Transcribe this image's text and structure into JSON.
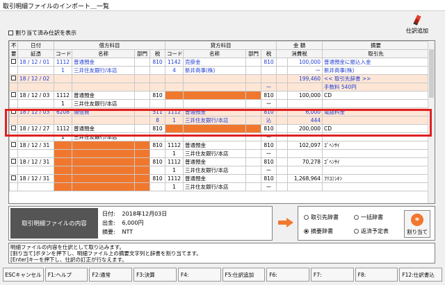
{
  "window": {
    "title": "取引明細ファイルのインポート＿一覧"
  },
  "toolbar": {
    "add_label": "仕訳追加"
  },
  "filter": {
    "show_assigned_label": "割り当て済み仕訳を表示"
  },
  "table": {
    "group_headers": {
      "nofuyo": "不",
      "date": "日付",
      "debit": "借方科目",
      "credit": "貸方科目",
      "amount": "金 額",
      "summary": "摘要"
    },
    "sub_headers": {
      "nofuyo": "要",
      "voucher": "証憑",
      "code": "コード",
      "name": "名称",
      "dept": "部門",
      "tax": "税",
      "tax_amount": "消費税",
      "partner": "取引先"
    },
    "rows": [
      {
        "style": "blue white",
        "check": true,
        "date": "18 / 12 / 01",
        "dcode": "1112",
        "dname": "普通預金",
        "ddept": "",
        "dtax": "810",
        "ccode": "1142",
        "cname": "売掛金",
        "cdept": "",
        "ctax": "810",
        "amount": "100,000",
        "summary": "普通預金に振込入金"
      },
      {
        "style": "blue white",
        "check": false,
        "date": "",
        "dcode": "1",
        "dname": "三井住友銀行/本店",
        "ddept": "",
        "dtax": "",
        "ccode": "4",
        "cname": "新井商事(株)",
        "cdept": "",
        "ctax": "",
        "amount": "ー",
        "summary": "新井商事(株)"
      },
      {
        "style": "blue peach",
        "check": true,
        "date": "18 / 12 / 02",
        "dcode": "",
        "dname": "",
        "ddept": "",
        "dtax": "",
        "ccode": "",
        "cname": "",
        "cdept": "",
        "ctax": "",
        "amount": "199,460",
        "summary": "<< 取引先辞書 >>"
      },
      {
        "style": "blue peach",
        "check": false,
        "date": "",
        "dcode": "",
        "dname": "",
        "ddept": "",
        "dtax": "",
        "ccode": "",
        "cname": "",
        "cdept": "",
        "ctax": "ー",
        "amount": "",
        "summary": "手数料 540円"
      },
      {
        "style": "white",
        "check": true,
        "date": "18 / 12 / 03",
        "dcode": "1112",
        "dname": "普通預金",
        "ddept": "",
        "dtax": "810",
        "ccode": "",
        "cname": "",
        "cdept": "",
        "ctax": "810",
        "amount": "100,000",
        "summary": "CD",
        "corange": true
      },
      {
        "style": "white",
        "check": false,
        "date": "",
        "dcode": "1",
        "dname": "三井住友銀行/本店",
        "ddept": "",
        "dtax": "",
        "ccode": "",
        "cname": "",
        "cdept": "",
        "ctax": "ー",
        "amount": "",
        "summary": ""
      },
      {
        "style": "blue peach",
        "check": true,
        "date": "18 / 12 / 03",
        "dcode": "6208",
        "dname": "通信費",
        "ddept": "",
        "dtax": "511",
        "ccode": "1112",
        "cname": "普通預金",
        "cdept": "",
        "ctax": "810",
        "amount": "6,000",
        "summary": "電話料金"
      },
      {
        "style": "blue peach",
        "check": false,
        "date": "",
        "dcode": "",
        "dname": "",
        "ddept": "",
        "dtax": "8",
        "ccode": "1",
        "cname": "三井住友銀行/本店",
        "cdept": "",
        "ctax": "込",
        "amount": "444",
        "summary": ""
      },
      {
        "style": "white",
        "check": true,
        "date": "18 / 12 / 27",
        "dcode": "1112",
        "dname": "普通預金",
        "ddept": "",
        "dtax": "810",
        "ccode": "",
        "cname": "",
        "cdept": "",
        "ctax": "810",
        "amount": "200,000",
        "summary": "CD",
        "corange": true
      },
      {
        "style": "white",
        "check": false,
        "date": "",
        "dcode": "1",
        "dname": "三井住友銀行/本店",
        "ddept": "",
        "dtax": "",
        "ccode": "",
        "cname": "",
        "cdept": "",
        "ctax": "ー",
        "amount": "",
        "summary": ""
      },
      {
        "style": "white",
        "check": true,
        "date": "18 / 12 / 31",
        "dcode": "",
        "dname": "",
        "ddept": "",
        "dtax": "810",
        "ccode": "1112",
        "cname": "普通預金",
        "cdept": "",
        "ctax": "810",
        "amount": "102,097",
        "summary": "ｺﾞﾍﾝｻｲ",
        "dorange": true
      },
      {
        "style": "white",
        "check": false,
        "date": "",
        "dcode": "",
        "dname": "",
        "ddept": "",
        "dtax": "",
        "ccode": "1",
        "cname": "三井住友銀行/本店",
        "cdept": "",
        "ctax": "ー",
        "amount": "",
        "summary": "",
        "dorange": true
      },
      {
        "style": "white",
        "check": true,
        "date": "18 / 12 / 31",
        "dcode": "",
        "dname": "",
        "ddept": "",
        "dtax": "810",
        "ccode": "1112",
        "cname": "普通預金",
        "cdept": "",
        "ctax": "810",
        "amount": "70,278",
        "summary": "ｺﾞﾍﾝｻｲ",
        "dorange": true
      },
      {
        "style": "white",
        "check": false,
        "date": "",
        "dcode": "",
        "dname": "",
        "ddept": "",
        "dtax": "",
        "ccode": "1",
        "cname": "三井住友銀行/本店",
        "cdept": "",
        "ctax": "ー",
        "amount": "",
        "summary": "",
        "dorange": true
      },
      {
        "style": "white",
        "check": true,
        "date": "18 / 12 / 31",
        "dcode": "",
        "dname": "",
        "ddept": "",
        "dtax": "810",
        "ccode": "1112",
        "cname": "普通預金",
        "cdept": "",
        "ctax": "810",
        "amount": "1,268,964",
        "summary": "ﾌﾘｺﾐｼｷﾝ",
        "dorange": true
      },
      {
        "style": "white",
        "check": false,
        "date": "",
        "dcode": "",
        "dname": "",
        "ddept": "",
        "dtax": "",
        "ccode": "1",
        "cname": "三井住友銀行/本店",
        "cdept": "",
        "ctax": "ー",
        "amount": "",
        "summary": "",
        "dorange": true
      }
    ]
  },
  "detail": {
    "label": "取引明細ファイルの内容",
    "date_key": "日付:",
    "date_val": "2018年12月03日",
    "out_key": "出金:",
    "out_val": "6,000円",
    "memo_key": "摘要:",
    "memo_val": "NTT"
  },
  "dictionary": {
    "opt_partner": "取引先辞書",
    "opt_bulk": "一括辞書",
    "opt_summary": "摘要辞書",
    "opt_repay": "返済予定表",
    "assign_label": "割り当て"
  },
  "message": {
    "line1": "明細ファイルの内容を仕訳として取り込みます。",
    "line2": "[割り当て]ボタンを押下し、明細ファイル上の摘要文字列と辞書を割り当てます。",
    "line3": "[Enter]キーを押下し、仕訳の訂正が行なえます。"
  },
  "fkeys": [
    "ESCキャンセル",
    "F1:ヘルプ",
    "F2:通常",
    "F3:決算",
    "F4:",
    "F5:仕訳追加",
    "F6:",
    "F7:",
    "F8:",
    "F12:仕訳書込"
  ],
  "colors": {
    "highlight": "#e02020",
    "accent": "#f0782e",
    "row_peach": "#fde6d6",
    "text_blue": "#1d3bd1"
  }
}
